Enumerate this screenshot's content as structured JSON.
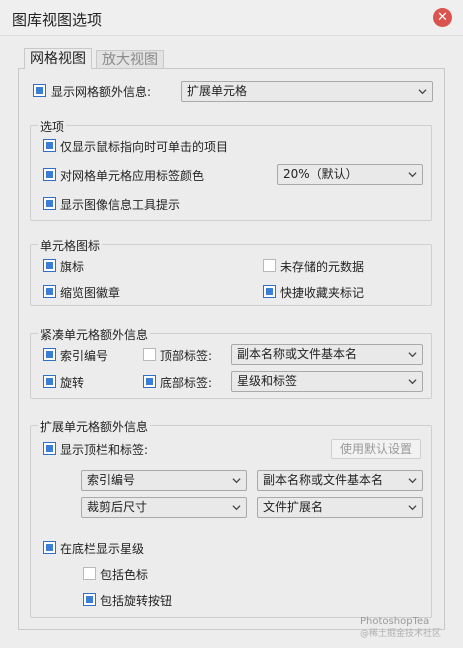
{
  "window": {
    "title": "图库视图选项"
  },
  "tabs": [
    {
      "label": "网格视图",
      "active": true
    },
    {
      "label": "放大视图",
      "active": false
    }
  ],
  "top": {
    "show_extra_label": "显示网格额外信息:",
    "show_extra_checked": true,
    "mode_select": "扩展单元格"
  },
  "options": {
    "legend": "选项",
    "items": [
      {
        "label": "仅显示鼠标指向时可单击的项目",
        "checked": true
      },
      {
        "label": "对网格单元格应用标签颜色",
        "checked": true
      },
      {
        "label": "显示图像信息工具提示",
        "checked": true
      }
    ],
    "tint_select": "20%（默认）"
  },
  "cell_icons": {
    "legend": "单元格图标",
    "items": [
      {
        "label": "旗标",
        "checked": true
      },
      {
        "label": "未存储的元数据",
        "checked": false
      },
      {
        "label": "缩览图徽章",
        "checked": true
      },
      {
        "label": "快捷收藏夹标记",
        "checked": true
      }
    ]
  },
  "compact": {
    "legend": "紧凑单元格额外信息",
    "index_label": "索引编号",
    "index_checked": true,
    "top_label": "顶部标签:",
    "top_checked": false,
    "top_select": "副本名称或文件基本名",
    "rotate_label": "旋转",
    "rotate_checked": true,
    "bottom_label": "底部标签:",
    "bottom_checked": true,
    "bottom_select": "星级和标签"
  },
  "expanded": {
    "legend": "扩展单元格额外信息",
    "show_header_label": "显示顶栏和标签:",
    "show_header_checked": true,
    "use_default_button": "使用默认设置",
    "selects": [
      "索引编号",
      "副本名称或文件基本名",
      "裁剪后尺寸",
      "文件扩展名"
    ],
    "show_rating_label": "在底栏显示星级",
    "show_rating_checked": true,
    "include_color_label": "包括色标",
    "include_color_checked": false,
    "include_rotate_label": "包括旋转按钮",
    "include_rotate_checked": true
  },
  "watermark": {
    "line1": "PhotoshopTea",
    "line2": "@稀土掘金技术社区"
  },
  "colors": {
    "accent": "#3a7fd5",
    "close": "#d9534f"
  }
}
